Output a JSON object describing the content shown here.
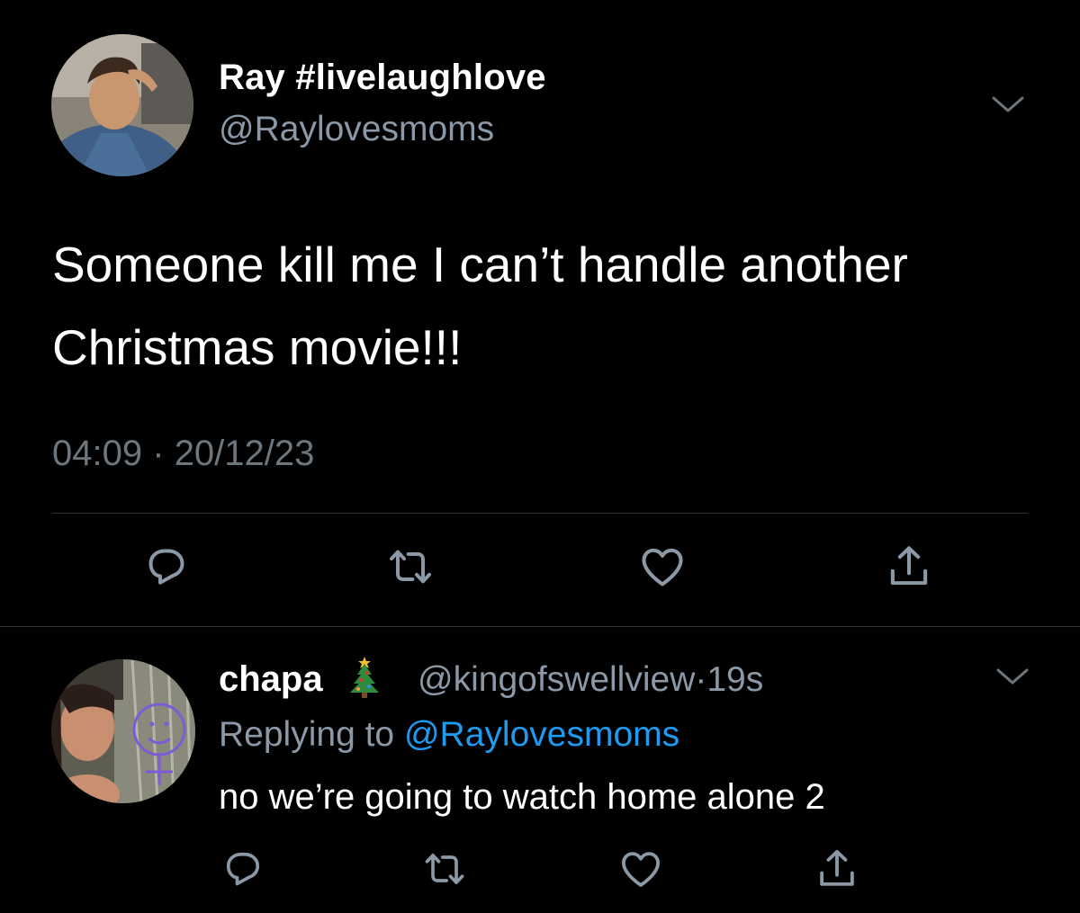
{
  "main_tweet": {
    "display_name": "Ray #livelaughlove",
    "handle": "@Raylovesmoms",
    "text": "Someone kill me I can’t handle another Christmas movie!!!",
    "time": "04:09",
    "separator": "·",
    "date": "20/12/23",
    "avatar_icon": "profile-photo",
    "menu_icon": "chevron-down-icon"
  },
  "reply_tweet": {
    "display_name": "chapa",
    "name_emoji": "christmas-tree-icon",
    "handle_time": "@kingofswellview·19s",
    "replying_prefix": "Replying to",
    "replying_handle": "@Raylovesmoms",
    "text": "no we’re going to watch home alone 2",
    "avatar_icon": "profile-photo",
    "menu_icon": "chevron-down-icon"
  },
  "actions": [
    "reply-icon",
    "retweet-icon",
    "like-icon",
    "share-icon"
  ],
  "colors": {
    "background": "#000000",
    "text_primary": "#ffffff",
    "text_secondary": "#8b98a5",
    "text_meta": "#6e767d",
    "link": "#1d9bf0",
    "divider": "#2f3336",
    "icon": "#8b98a5"
  }
}
